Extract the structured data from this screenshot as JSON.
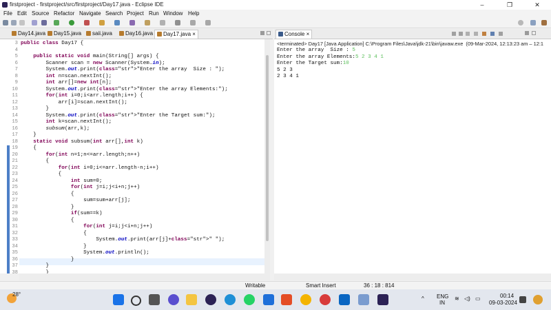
{
  "window": {
    "title": "firstproject - firstproject/src/firstproject/Day17.java - Eclipse IDE"
  },
  "window_buttons": [
    "–",
    "❐",
    "✕"
  ],
  "menu": [
    "File",
    "Edit",
    "Source",
    "Refactor",
    "Navigate",
    "Search",
    "Project",
    "Run",
    "Window",
    "Help"
  ],
  "editor_tabs": [
    {
      "label": "Day14.java"
    },
    {
      "label": "Day15.java"
    },
    {
      "label": "saii.java"
    },
    {
      "label": "Day16.java"
    },
    {
      "label": "Day17.java",
      "close": "×"
    }
  ],
  "editor": {
    "line_numbers": [
      "3",
      "4",
      "5",
      "6",
      "7",
      "8",
      "9",
      "10",
      "11",
      "12",
      "13",
      "14",
      "15",
      "16",
      "17",
      "18",
      "19",
      "20",
      "21",
      "22",
      "23",
      "24",
      "25",
      "26",
      "27",
      "28",
      "29",
      "30",
      "31",
      "32",
      "33",
      "34",
      "35",
      "36",
      "37",
      "38"
    ],
    "lines": [
      "public class Day17 {",
      "",
      "    public static void main(String[] args) {",
      "        Scanner scan = new Scanner(System.in);",
      "        System.out.print(\"Enter the array  Size : \");",
      "        int n=scan.nextInt();",
      "        int arr[]=new int[n];",
      "        System.out.print(\"Enter the array Elements:\");",
      "        for(int i=0;i<arr.length;i++) {",
      "            arr[i]=scan.nextInt();",
      "        }",
      "        System.out.print(\"Enter the Target sum:\");",
      "        int k=scan.nextInt();",
      "        subsum(arr,k);",
      "    }",
      "    static void subsum(int arr[],int k)",
      "    {",
      "        for(int n=1;n<=arr.length;n++)",
      "        {",
      "            for(int i=0;i<=arr.length-n;i++)",
      "            {",
      "                int sum=0;",
      "                for(int j=i;j<i+n;j++)",
      "                {",
      "                    sum=sum+arr[j];",
      "                }",
      "                if(sum==k)",
      "                {",
      "                    for(int j=i;j<i+n;j++)",
      "                    {",
      "                        System.out.print(arr[j]+\" \");",
      "                    }",
      "                    System.out.println();",
      "                }",
      "        }",
      "        }"
    ]
  },
  "console": {
    "tab_label": "Console",
    "close": "×",
    "header": "<terminated> Day17 [Java Application] C:\\Program Files\\Java\\jdk-21\\bin\\javaw.exe  (09-Mar-2024, 12:13:23 am – 12:1",
    "lines": [
      {
        "prompt": "Enter the array  Size : ",
        "input": "5"
      },
      {
        "prompt": "Enter the array Elements:",
        "input": "5 2 3 4 1"
      },
      {
        "prompt": "Enter the Target sum:",
        "input": "10"
      },
      {
        "prompt": "5 2 3",
        "input": ""
      },
      {
        "prompt": "2 3 4 1",
        "input": ""
      }
    ]
  },
  "status": {
    "mode": "Writable",
    "insert": "Smart Insert",
    "position": "36 : 18 : 814"
  },
  "taskbar": {
    "weather": "28°",
    "tray": {
      "lang": "ENG",
      "region": "IN",
      "time": "00:14",
      "date": "09-03-2024"
    },
    "colors": {
      "blue": "#1e6fd9",
      "start": "#1a73e8"
    }
  }
}
